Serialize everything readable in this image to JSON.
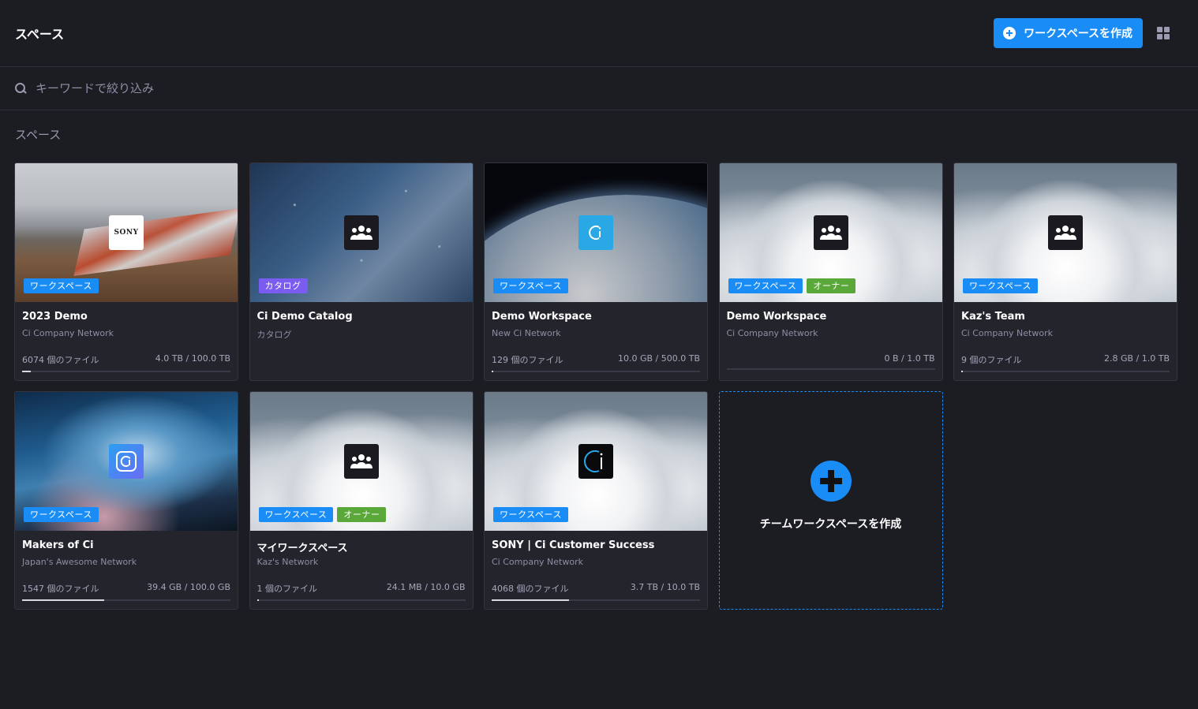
{
  "header": {
    "title": "スペース",
    "create_label": "ワークスペースを作成",
    "grid_view_icon": "grid-view-icon"
  },
  "search": {
    "placeholder": "キーワードで絞り込み",
    "value": ""
  },
  "section": {
    "title": "スペース"
  },
  "colors": {
    "accent": "#1a8cf5",
    "background": "#1c1c23",
    "card": "#24242d",
    "badge_catalog": "#7a5cf0",
    "badge_owner": "#5aa83a"
  },
  "cards": [
    {
      "name": "2023 Demo",
      "network": "Ci Company Network",
      "files": "6074 個のファイル",
      "storage": "4.0 TB / 100.0 TB",
      "usage_fraction": 0.04,
      "badges": [
        "ワークスペース"
      ],
      "logo": "sony-logo",
      "logo_text": "SONY",
      "thumbnail": "beach-windsurf-photo"
    },
    {
      "name": "Ci Demo Catalog",
      "network": "カタログ",
      "files": "",
      "storage": "",
      "usage_fraction": null,
      "badges": [
        "カタログ"
      ],
      "logo": "team-icon",
      "thumbnail": "starry-sky-photo"
    },
    {
      "name": "Demo Workspace",
      "network": "New Ci Network",
      "files": "129 個のファイル",
      "storage": "10.0 GB / 500.0 TB",
      "usage_fraction": 0.001,
      "badges": [
        "ワークスペース"
      ],
      "logo": "ci-logo",
      "thumbnail": "earth-from-space-photo"
    },
    {
      "name": "Demo Workspace",
      "network": "Ci Company Network",
      "files": "",
      "storage": "0 B / 1.0 TB",
      "usage_fraction": 0,
      "badges": [
        "ワークスペース",
        "オーナー"
      ],
      "logo": "team-icon",
      "thumbnail": "clouds-photo"
    },
    {
      "name": "Kaz's Team",
      "network": "Ci Company Network",
      "files": "9 個のファイル",
      "storage": "2.8 GB / 1.0 TB",
      "usage_fraction": 0.003,
      "badges": [
        "ワークスペース"
      ],
      "logo": "team-icon",
      "thumbnail": "clouds-photo"
    },
    {
      "name": "Makers of Ci",
      "network": "Japan's Awesome Network",
      "files": "1547 個のファイル",
      "storage": "39.4 GB / 100.0 GB",
      "usage_fraction": 0.394,
      "badges": [
        "ワークスペース"
      ],
      "logo": "ci-gradient-logo",
      "thumbnail": "stormy-sky-photo"
    },
    {
      "name": "マイワークスペース",
      "network": "Kaz's Network",
      "files": "1 個のファイル",
      "storage": "24.1 MB / 10.0 GB",
      "usage_fraction": 0.002,
      "badges": [
        "ワークスペース",
        "オーナー"
      ],
      "logo": "team-icon",
      "thumbnail": "clouds-photo"
    },
    {
      "name": "SONY | Ci Customer Success",
      "network": "Ci Company Network",
      "files": "4068 個のファイル",
      "storage": "3.7 TB / 10.0 TB",
      "usage_fraction": 0.37,
      "badges": [
        "ワークスペース"
      ],
      "logo": "ci-dark-logo",
      "thumbnail": "clouds-photo"
    }
  ],
  "new_card": {
    "label": "チームワークスペースを作成"
  }
}
